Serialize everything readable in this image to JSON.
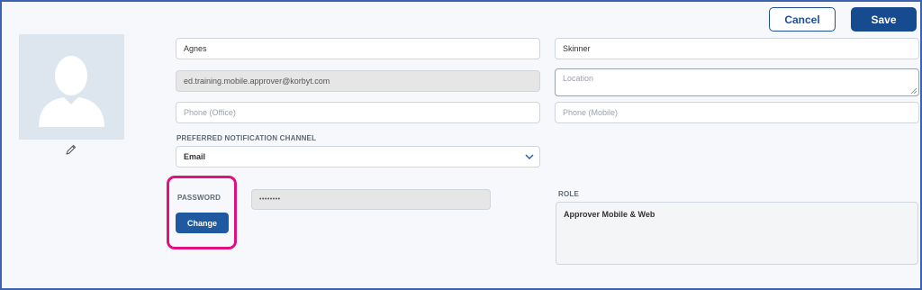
{
  "toolbar": {
    "cancel_label": "Cancel",
    "save_label": "Save"
  },
  "profile": {
    "first_name": "Agnes",
    "last_name": "Skinner",
    "email": "ed.training.mobile.approver@korbyt.com",
    "location_placeholder": "Location",
    "phone_office_placeholder": "Phone (Office)",
    "phone_mobile_placeholder": "Phone (Mobile)"
  },
  "notification": {
    "label": "PREFERRED NOTIFICATION CHANNEL",
    "selected": "Email"
  },
  "password": {
    "label": "PASSWORD",
    "masked_value": "••••••••",
    "change_label": "Change"
  },
  "role": {
    "label": "ROLE",
    "value": "Approver Mobile & Web"
  },
  "colors": {
    "primary": "#174b8f",
    "highlight": "#e0117f",
    "frame": "#3d63b0"
  },
  "icons": [
    "user-avatar-icon",
    "pencil-icon",
    "chevron-down-icon"
  ]
}
